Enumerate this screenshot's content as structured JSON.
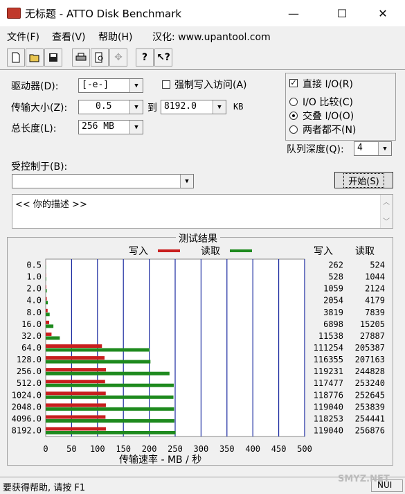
{
  "window": {
    "title": "无标题 - ATTO Disk Benchmark",
    "minimize": "—",
    "maximize": "☐",
    "close": "✕"
  },
  "menu": [
    "文件(F)",
    "查看(V)",
    "帮助(H)",
    "汉化: www.upantool.com"
  ],
  "toolbar": [
    "new-icon",
    "open-icon",
    "save-icon",
    "print-icon",
    "print-preview-icon",
    "move-icon",
    "help-icon",
    "context-help-icon"
  ],
  "form": {
    "drive_label": "驱动器(D):",
    "drive_value": "[-e-]",
    "force_write_label": "强制写入访问(A)",
    "transfer_label": "传输大小(Z):",
    "transfer_from": "0.5",
    "to_label": "到",
    "transfer_to": "8192.0",
    "kb_label": "KB",
    "length_label": "总长度(L):",
    "length_value": "256 MB",
    "controlled_label": "受控制于(B):",
    "controlled_value": "",
    "start_button": "开始(S)",
    "description": "<<  你的描述   >>",
    "direct_io_label": "直接 I/O(R)",
    "direct_io_checked": true,
    "io_compare": "I/O 比较(C)",
    "overlap_io": "交叠 I/O(O)",
    "neither": "两者都不(N)",
    "queue_label": "队列深度(Q):",
    "queue_value": "4"
  },
  "results": {
    "title": "测试结果",
    "write_legend": "写入",
    "read_legend": "读取",
    "write_header": "写入",
    "read_header": "读取",
    "write_color": "#c81e1e",
    "read_color": "#1e8a1e",
    "grid_color": "#1a2aa0",
    "xlabel": "传输速率 - MB / 秒"
  },
  "chart_data": {
    "type": "bar",
    "orientation": "horizontal",
    "categories": [
      "0.5",
      "1.0",
      "2.0",
      "4.0",
      "8.0",
      "16.0",
      "32.0",
      "64.0",
      "128.0",
      "256.0",
      "512.0",
      "1024.0",
      "2048.0",
      "4096.0",
      "8192.0"
    ],
    "series": [
      {
        "name": "写入",
        "values": [
          262,
          528,
          1059,
          2054,
          3819,
          6898,
          11538,
          111254,
          116355,
          119231,
          117477,
          118776,
          119040,
          118253,
          119040
        ]
      },
      {
        "name": "读取",
        "values": [
          524,
          1044,
          2124,
          4179,
          7839,
          15205,
          27887,
          205387,
          207163,
          244828,
          253240,
          252645,
          253839,
          254441,
          256876
        ]
      }
    ],
    "unit_scale_note_values_in": "KB/s",
    "xticks": [
      "0",
      "50",
      "100",
      "150",
      "200",
      "250",
      "300",
      "350",
      "400",
      "450",
      "500"
    ],
    "xlim": [
      0,
      500
    ],
    "xlabel": "传输速率 - MB / 秒"
  },
  "status": {
    "help_text": "要获得帮助, 请按 F1",
    "num": "NUI"
  },
  "watermark": "SMYZ.NET"
}
